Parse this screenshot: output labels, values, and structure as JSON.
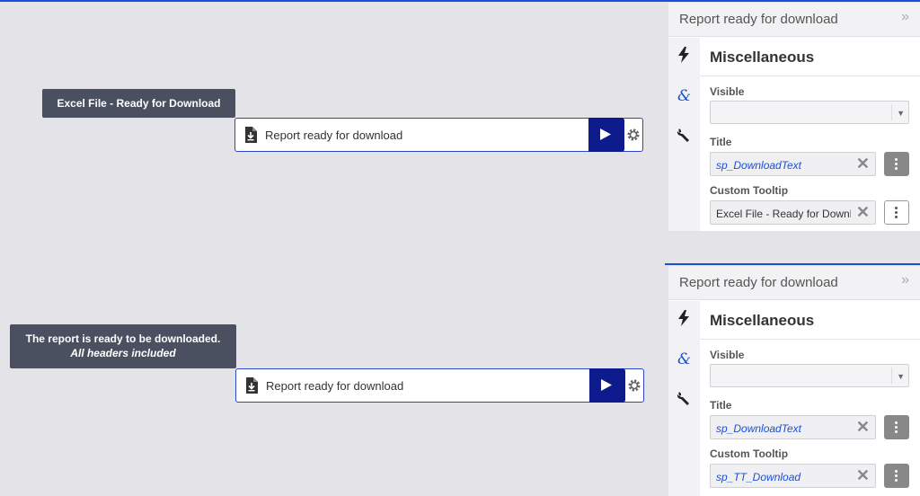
{
  "canvas": {
    "tooltip1": "Excel File - Ready for Download",
    "tooltip2_line1": "The report is ready to be downloaded.",
    "tooltip2_line2": "All headers included",
    "button1_label": "Report ready for download",
    "button2_label": "Report ready for download"
  },
  "panels": [
    {
      "header_title": "Report ready for download",
      "section": "Miscellaneous",
      "visible_label": "Visible",
      "title_label": "Title",
      "title_value": "sp_DownloadText",
      "tooltip_label": "Custom Tooltip",
      "tooltip_value": "Excel File - Ready for Download"
    },
    {
      "header_title": "Report ready for download",
      "section": "Miscellaneous",
      "visible_label": "Visible",
      "title_label": "Title",
      "title_value": "sp_DownloadText",
      "tooltip_label": "Custom Tooltip",
      "tooltip_value": "sp_TT_Download"
    }
  ],
  "icons": {
    "expand": "double-chevron-right-icon",
    "events": "lightning-icon",
    "expressions": "ampersand-icon",
    "properties": "wrench-icon",
    "download": "file-download-icon",
    "play": "play-icon",
    "settings": "gear-icon",
    "clear": "close-icon",
    "more": "kebab-icon"
  },
  "colors": {
    "accent": "#1a4fd6",
    "play_button": "#0d1b8c",
    "tooltip_bg": "#4a5060"
  }
}
